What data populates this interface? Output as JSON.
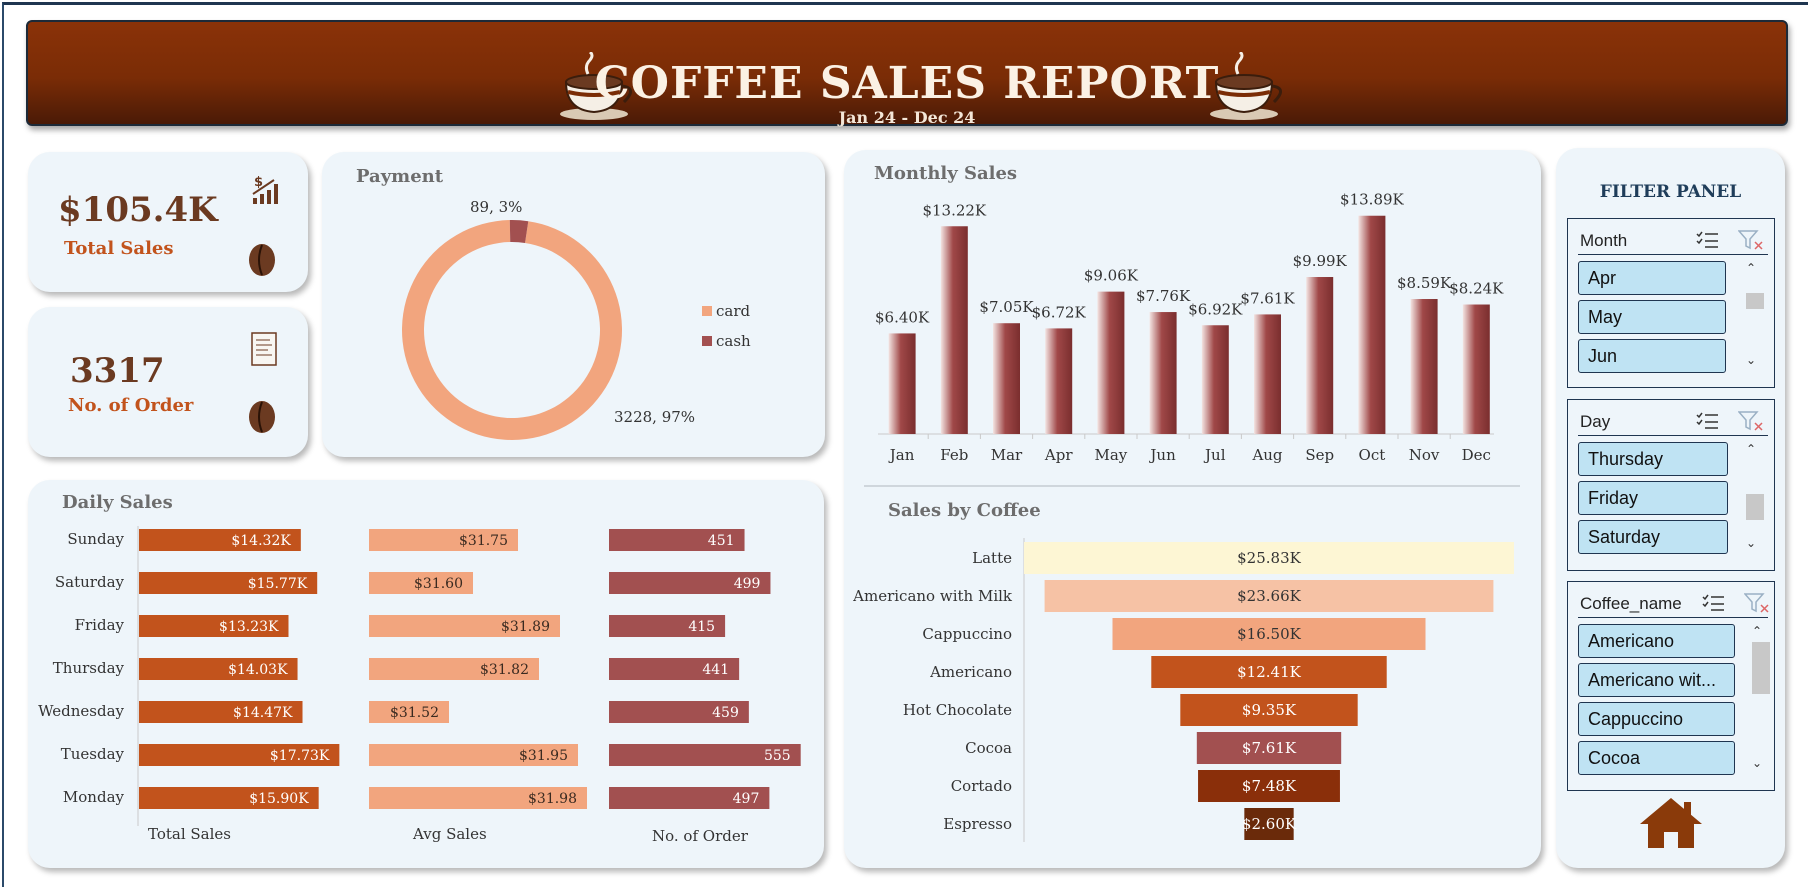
{
  "header": {
    "title": "COFFEE SALES REPORT",
    "subtitle": "Jan 24 - Dec 24"
  },
  "kpis": {
    "total_sales_value": "$105.4K",
    "total_sales_label": "Total Sales",
    "orders_value": "3317",
    "orders_label": "No. of Order"
  },
  "payment": {
    "title": "Payment",
    "card_label": "3228, 97%",
    "cash_label": "89, 3%",
    "legend": [
      "card",
      "cash"
    ],
    "colors": {
      "card": "#f2a57e",
      "cash": "#a25050"
    }
  },
  "monthly": {
    "title": "Monthly Sales"
  },
  "coffee": {
    "title": "Sales by Coffee"
  },
  "daily": {
    "title": "Daily Sales",
    "axis_titles": [
      "Total Sales",
      "Avg Sales",
      "No. of Order"
    ]
  },
  "filter_panel": {
    "title": "FILTER PANEL",
    "month": {
      "name": "Month",
      "items": [
        "Apr",
        "May",
        "Jun"
      ]
    },
    "day": {
      "name": "Day",
      "items": [
        "Thursday",
        "Friday",
        "Saturday"
      ]
    },
    "coffee_name": {
      "name": "Coffee_name",
      "items": [
        "Americano",
        "Americano wit...",
        "Cappuccino",
        "Cocoa"
      ]
    }
  },
  "icons": [
    "coffee-cup-icon",
    "dollar-chart-icon",
    "coffee-bean-icon",
    "receipt-icon",
    "multi-select-icon",
    "clear-filter-icon",
    "home-icon"
  ],
  "chart_data": [
    {
      "type": "pie",
      "title": "Payment",
      "categories": [
        "card",
        "cash"
      ],
      "values": [
        3228,
        89
      ],
      "percent": [
        97,
        3
      ],
      "donut": true
    },
    {
      "type": "bar",
      "title": "Monthly Sales",
      "categories": [
        "Jan",
        "Feb",
        "Mar",
        "Apr",
        "May",
        "Jun",
        "Jul",
        "Aug",
        "Sep",
        "Oct",
        "Nov",
        "Dec"
      ],
      "values": [
        6.4,
        13.22,
        7.05,
        6.72,
        9.06,
        7.76,
        6.92,
        7.61,
        9.99,
        13.89,
        8.59,
        8.24
      ],
      "labels": [
        "$6.40K",
        "$13.22K",
        "$7.05K",
        "$6.72K",
        "$9.06K",
        "$7.76K",
        "$6.92K",
        "$7.61K",
        "$9.99K",
        "$13.89K",
        "$8.59K",
        "$8.24K"
      ],
      "unit": "$K"
    },
    {
      "type": "bar",
      "title": "Sales by Coffee",
      "orientation": "horizontal-funnel",
      "categories": [
        "Latte",
        "Americano with Milk",
        "Cappuccino",
        "Americano",
        "Hot Chocolate",
        "Cocoa",
        "Cortado",
        "Espresso"
      ],
      "values": [
        25.83,
        23.66,
        16.5,
        12.41,
        9.35,
        7.61,
        7.48,
        2.6
      ],
      "labels": [
        "$25.83K",
        "$23.66K",
        "$16.50K",
        "$12.41K",
        "$9.35K",
        "$7.61K",
        "$7.48K",
        "$2.60K"
      ],
      "colors": [
        "#fdf6d4",
        "#f6c2a5",
        "#f2a57e",
        "#c2531c",
        "#c2531c",
        "#a25050",
        "#8a2f0a",
        "#6a2a0a"
      ],
      "unit": "$K"
    },
    {
      "type": "bar",
      "title": "Daily Sales",
      "orientation": "horizontal",
      "categories": [
        "Sunday",
        "Saturday",
        "Friday",
        "Thursday",
        "Wednesday",
        "Tuesday",
        "Monday"
      ],
      "series": [
        {
          "name": "Total Sales",
          "values": [
            14.32,
            15.77,
            13.23,
            14.03,
            14.47,
            17.73,
            15.9
          ],
          "labels": [
            "$14.32K",
            "$15.77K",
            "$13.23K",
            "$14.03K",
            "$14.47K",
            "$17.73K",
            "$15.90K"
          ],
          "color": "#c2531c"
        },
        {
          "name": "Avg Sales",
          "values": [
            31.75,
            31.6,
            31.89,
            31.82,
            31.52,
            31.95,
            31.98
          ],
          "labels": [
            "$31.75",
            "$31.60",
            "$31.89",
            "$31.82",
            "$31.52",
            "$31.95",
            "$31.98"
          ],
          "color": "#f2a57e"
        },
        {
          "name": "No. of Order",
          "values": [
            451,
            499,
            415,
            441,
            459,
            555,
            497
          ],
          "labels": [
            "451",
            "499",
            "415",
            "441",
            "459",
            "555",
            "497"
          ],
          "color": "#a25050"
        }
      ]
    }
  ]
}
